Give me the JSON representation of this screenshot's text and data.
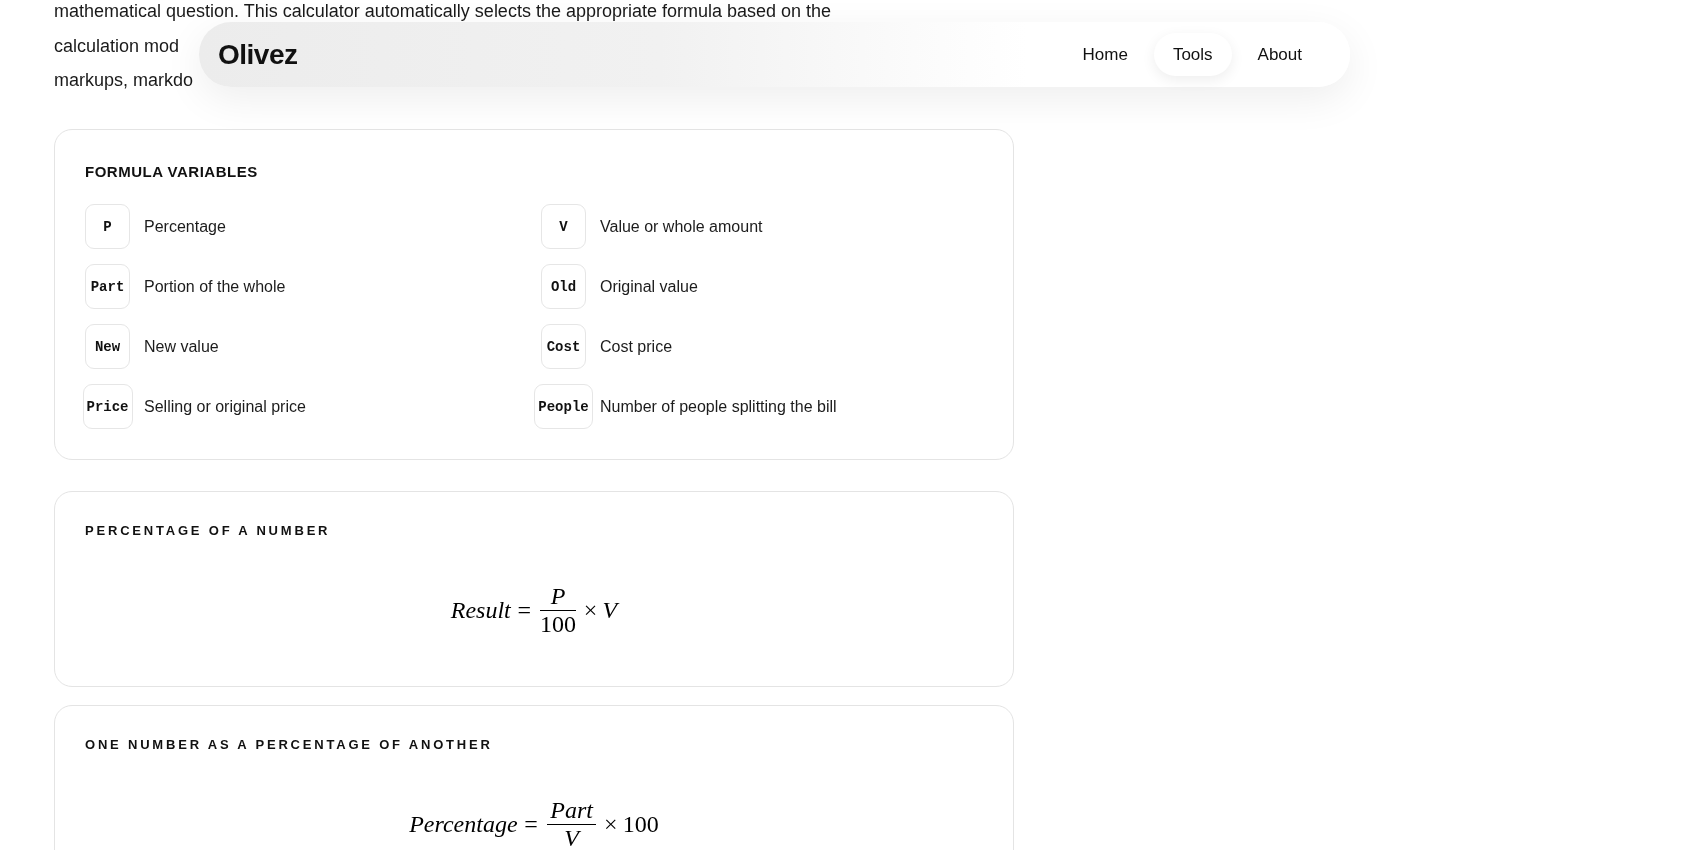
{
  "intro_lines": [
    "mathematical question. This calculator automatically selects the appropriate formula based on the",
    "calculation mod",
    "markups, markdo"
  ],
  "nav": {
    "logo": "Olivez",
    "links": [
      {
        "label": "Home",
        "selected": false
      },
      {
        "label": "Tools",
        "selected": true
      },
      {
        "label": "About",
        "selected": false
      }
    ]
  },
  "variables_card": {
    "title": "FORMULA VARIABLES",
    "items": [
      {
        "symbol": "P",
        "description": "Percentage"
      },
      {
        "symbol": "V",
        "description": "Value or whole amount"
      },
      {
        "symbol": "Part",
        "description": "Portion of the whole"
      },
      {
        "symbol": "Old",
        "description": "Original value"
      },
      {
        "symbol": "New",
        "description": "New value"
      },
      {
        "symbol": "Cost",
        "description": "Cost price"
      },
      {
        "symbol": "Price",
        "description": "Selling or original price"
      },
      {
        "symbol": "People",
        "description": "Number of people splitting the bill"
      }
    ]
  },
  "formula_cards": [
    {
      "title": "PERCENTAGE OF A NUMBER",
      "formula": {
        "lhs": "Result",
        "relation": "=",
        "numerator": {
          "kind": "variable",
          "text": "P"
        },
        "denominator": {
          "kind": "number",
          "text": "100"
        },
        "operator": "×",
        "factor": {
          "kind": "variable",
          "text": "V"
        }
      }
    },
    {
      "title": "ONE NUMBER AS A PERCENTAGE OF ANOTHER",
      "formula": {
        "lhs": "Percentage",
        "relation": "=",
        "numerator": {
          "kind": "variable",
          "text": "Part"
        },
        "denominator": {
          "kind": "variable",
          "text": "V"
        },
        "operator": "×",
        "factor": {
          "kind": "number",
          "text": "100"
        }
      }
    }
  ]
}
